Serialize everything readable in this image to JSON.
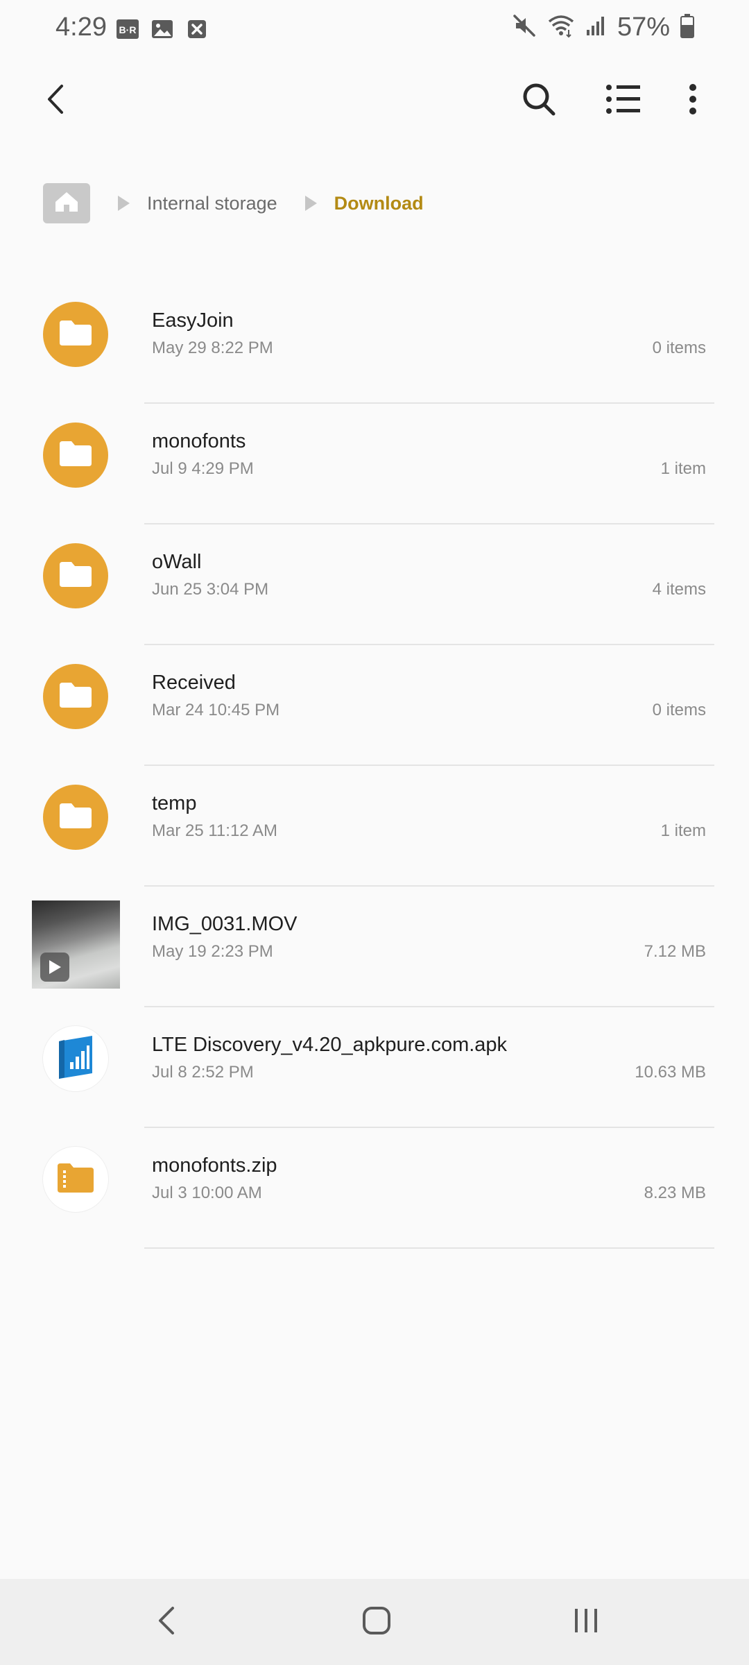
{
  "status_bar": {
    "time": "4:29",
    "battery": "57%",
    "left_icons": [
      "backup-restore-icon",
      "gallery-icon",
      "dismissed-notification-icon"
    ],
    "right_icons": [
      "mute-icon",
      "wifi-icon",
      "signal-icon",
      "battery-icon"
    ]
  },
  "app_bar": {
    "actions": [
      "back-arrow-icon",
      "search-icon",
      "list-view-icon",
      "more-options-icon"
    ]
  },
  "breadcrumb": {
    "home_icon": "home-folder-icon",
    "items": [
      "Internal storage",
      "Download"
    ],
    "active": "Download",
    "active_color": "#b38a14"
  },
  "files": [
    {
      "name": "EasyJoin",
      "date": "May 29 8:22 PM",
      "size": "0 items",
      "type": "folder"
    },
    {
      "name": "monofonts",
      "date": "Jul 9 4:29 PM",
      "size": "1 item",
      "type": "folder"
    },
    {
      "name": "oWall",
      "date": "Jun 25 3:04 PM",
      "size": "4 items",
      "type": "folder"
    },
    {
      "name": "Received",
      "date": "Mar 24 10:45 PM",
      "size": "0 items",
      "type": "folder"
    },
    {
      "name": "temp",
      "date": "Mar 25 11:12 AM",
      "size": "1 item",
      "type": "folder"
    },
    {
      "name": "IMG_0031.MOV",
      "date": "May 19 2:23 PM",
      "size": "7.12 MB",
      "type": "video"
    },
    {
      "name": "LTE Discovery_v4.20_apkpure.com.apk",
      "date": "Jul 8 2:52 PM",
      "size": "10.63 MB",
      "type": "apk"
    },
    {
      "name": "monofonts.zip",
      "date": "Jul 3 10:00 AM",
      "size": "8.23 MB",
      "type": "zip"
    }
  ],
  "colors": {
    "folder": "#e8a533",
    "apk_icon": "#1e88d6",
    "divider": "#e4e4e4"
  },
  "nav_bar": {
    "buttons": [
      "nav-back-icon",
      "nav-home-icon",
      "nav-recents-icon"
    ]
  }
}
